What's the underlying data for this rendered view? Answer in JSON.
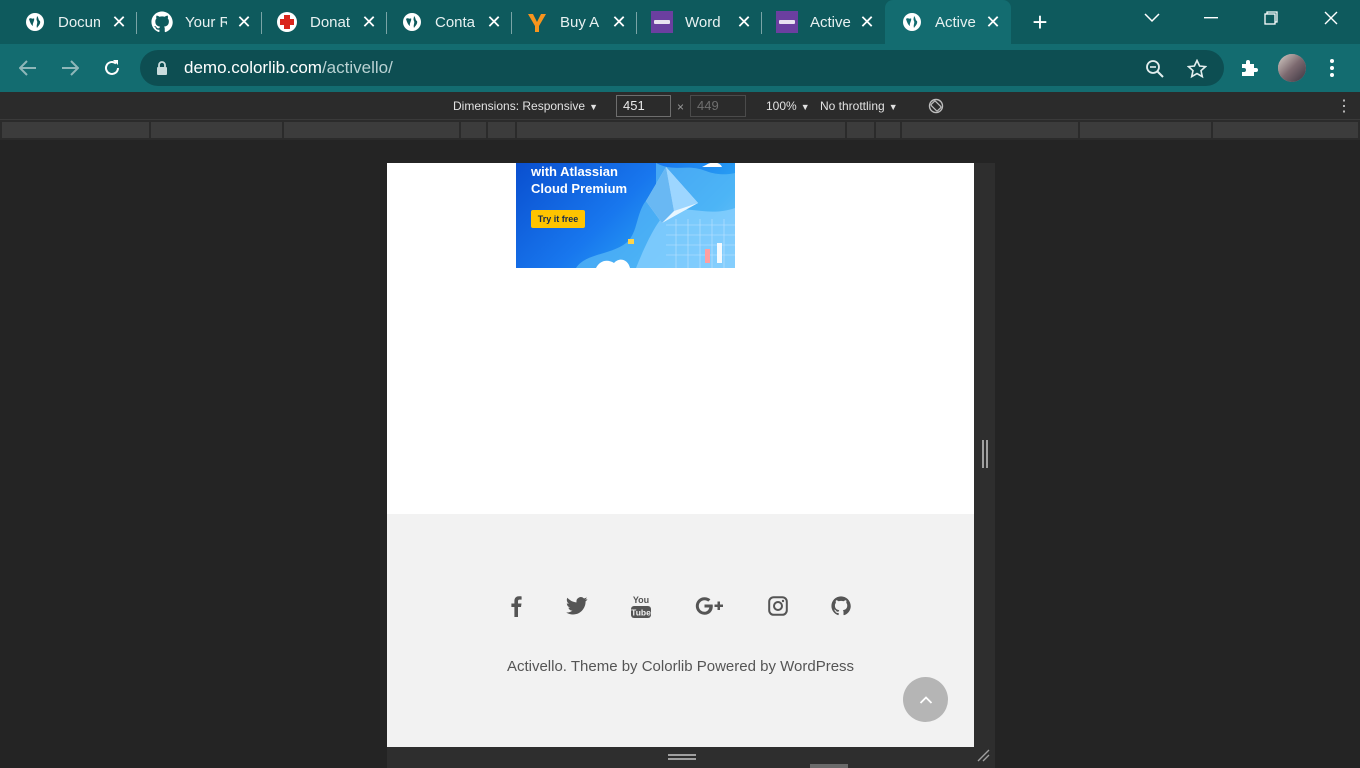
{
  "browser": {
    "tabs": [
      {
        "title": "Docum",
        "icon": "globe-icon",
        "active": false
      },
      {
        "title": "Your R",
        "icon": "github-icon",
        "active": false
      },
      {
        "title": "Donat",
        "icon": "red-cross-icon",
        "active": false
      },
      {
        "title": "Conta",
        "icon": "globe-icon",
        "active": false
      },
      {
        "title": "Buy A",
        "icon": "yoast-icon",
        "active": false
      },
      {
        "title": "Word",
        "icon": "colorlib-icon",
        "active": false
      },
      {
        "title": "Active",
        "icon": "colorlib-icon",
        "active": false
      },
      {
        "title": "Active",
        "icon": "globe-icon",
        "active": true
      }
    ],
    "url_domain": "demo.colorlib.com",
    "url_path": "/activello/"
  },
  "devtools": {
    "dimensions_label": "Dimensions: Responsive",
    "width_value": "451",
    "height_placeholder": "449",
    "times": "×",
    "zoom": "100%",
    "throttling": "No throttling"
  },
  "ad": {
    "line1": "with Atlassian",
    "line2": "Cloud Premium",
    "cta": "Try it free"
  },
  "footer": {
    "social_icons": [
      "facebook-icon",
      "twitter-icon",
      "youtube-icon",
      "google-plus-icon",
      "instagram-icon",
      "github-icon"
    ],
    "credit_site": "Activello. Theme by ",
    "credit_theme": "Colorlib",
    "credit_mid": " Powered by ",
    "credit_platform": "WordPress"
  },
  "colors": {
    "tabstrip": "#0e5a5d",
    "toolbar": "#136c70",
    "footer_bg": "#f2f2f2"
  }
}
